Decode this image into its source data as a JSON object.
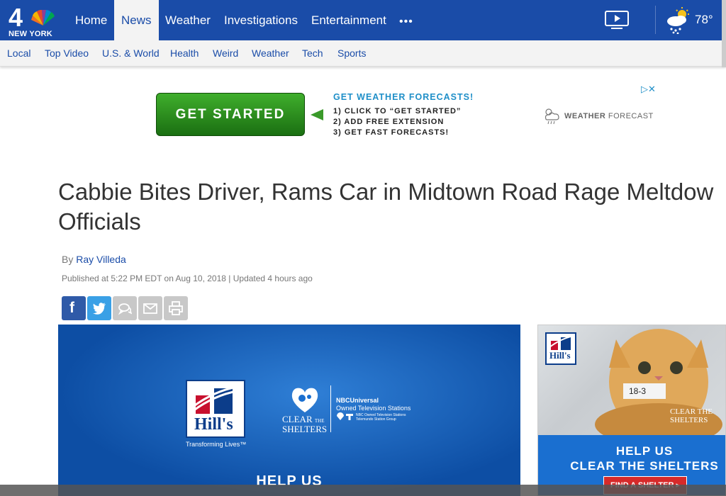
{
  "logo": {
    "number": "4",
    "station": "NEW YORK"
  },
  "nav": {
    "items": [
      {
        "label": "Home"
      },
      {
        "label": "News",
        "active": true
      },
      {
        "label": "Weather"
      },
      {
        "label": "Investigations"
      },
      {
        "label": "Entertainment"
      }
    ],
    "more": "•••",
    "temperature": "78°"
  },
  "subnav": {
    "items": [
      "Local",
      "Top Video",
      "U.S. & World",
      "Health",
      "Weird",
      "Weather",
      "Tech",
      "Sports"
    ]
  },
  "ad": {
    "button": "GET STARTED",
    "headline": "GET WEATHER FORECASTS!",
    "steps": [
      "1) CLICK TO “GET STARTED”",
      "2) ADD FREE EXTENSION",
      "3) GET FAST FORECASTS!"
    ],
    "brand_bold": "WEATHER",
    "brand_light": "FORECAST",
    "choices": "▷✕"
  },
  "article": {
    "headline_line1": "Cabbie Bites Driver, Rams Car in Midtown Road Rage Meltdow",
    "headline_line2": "Officials",
    "by": "By",
    "author": "Ray Villeda",
    "published": "Published at 5:22 PM EDT on Aug 10, 2018 | Updated 4 hours ago"
  },
  "share": {
    "facebook": "f"
  },
  "video": {
    "hills": "Hill's",
    "tagline": "Transforming Lives™",
    "clear_1": "CLEAR",
    "clear_2": "THE",
    "shelters": "SHELTERS",
    "nbc_1": "NBCUniversal",
    "nbc_2": "Owned Television Stations",
    "nbc_3": "NBC Owned Television Stations",
    "nbc_4": "Telemundo Station Group",
    "help": "HELP US"
  },
  "sidead": {
    "hills": "Hill's",
    "tag": "18-3",
    "clear": "CLEAR THE SHELTERS",
    "help_1": "HELP US",
    "help_2": "CLEAR THE SHELTERS",
    "find": "FIND A SHELTER ▸"
  },
  "colors": {
    "nav": "#1a4ca8",
    "accent_green": "#3a9a2a",
    "ad_blue": "#1f8fc8"
  }
}
